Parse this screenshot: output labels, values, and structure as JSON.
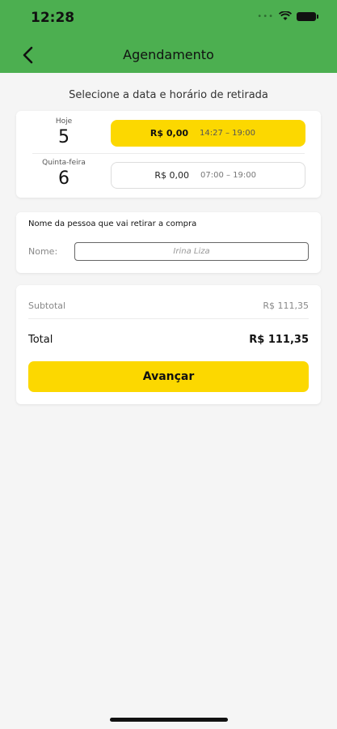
{
  "status": {
    "time": "12:28"
  },
  "header": {
    "title": "Agendamento"
  },
  "subtitle": "Selecione a data e horário de retirada",
  "days": [
    {
      "label": "Hoje",
      "number": "5",
      "price": "R$ 0,00",
      "range": "14:27 – 19:00",
      "selected": true
    },
    {
      "label": "Quinta-feira",
      "number": "6",
      "price": "R$ 0,00",
      "range": "07:00 – 19:00",
      "selected": false
    }
  ],
  "pickup": {
    "label": "Nome da pessoa que vai retirar a compra",
    "name_label": "Nome:",
    "name_value": "Irina Liza"
  },
  "summary": {
    "subtotal_label": "Subtotal",
    "subtotal_value": "R$ 111,35",
    "total_label": "Total",
    "total_value": "R$ 111,35"
  },
  "cta": {
    "label": "Avançar"
  },
  "colors": {
    "brand_green": "#4caf50",
    "accent_yellow": "#fcd800"
  }
}
